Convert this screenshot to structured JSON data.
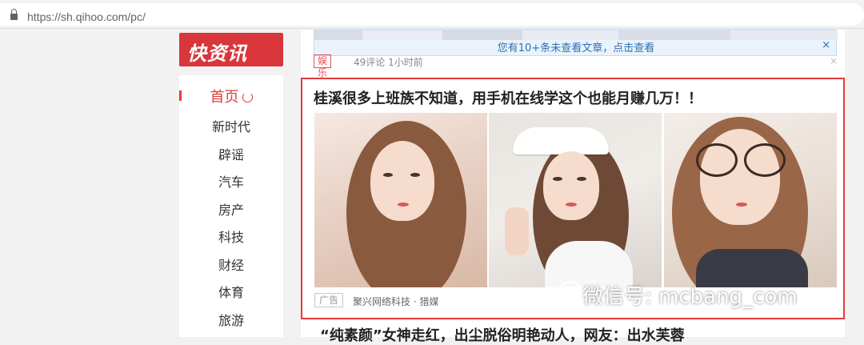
{
  "browser": {
    "url": "https://sh.qihoo.com/pc/"
  },
  "logo": {
    "text": "快资讯"
  },
  "sidebar": {
    "items": [
      {
        "label": "首页",
        "active": true
      },
      {
        "label": "新时代"
      },
      {
        "label": "辟谣"
      },
      {
        "label": "汽车"
      },
      {
        "label": "房产"
      },
      {
        "label": "科技"
      },
      {
        "label": "财经"
      },
      {
        "label": "体育"
      },
      {
        "label": "旅游"
      }
    ]
  },
  "banner": {
    "message": "您有10+条未查看文章，点击查看",
    "close": "×"
  },
  "prev_meta": {
    "tag": "娱乐",
    "info": "49评论  1小时前",
    "close": "×"
  },
  "ad": {
    "title": "桂溪很多上班族不知道，用手机在线学这个也能月赚几万！！",
    "tag": "广告",
    "source": "聚兴网络科技 · 猎媒"
  },
  "watermark": {
    "text": "微信号: mcbang_com"
  },
  "next_article": {
    "title": "“纯素颜”女神走红，出尘脱俗明艳动人，网友：出水芙蓉"
  },
  "colors": {
    "accent": "#e23b3b",
    "link": "#2f6fb4"
  }
}
